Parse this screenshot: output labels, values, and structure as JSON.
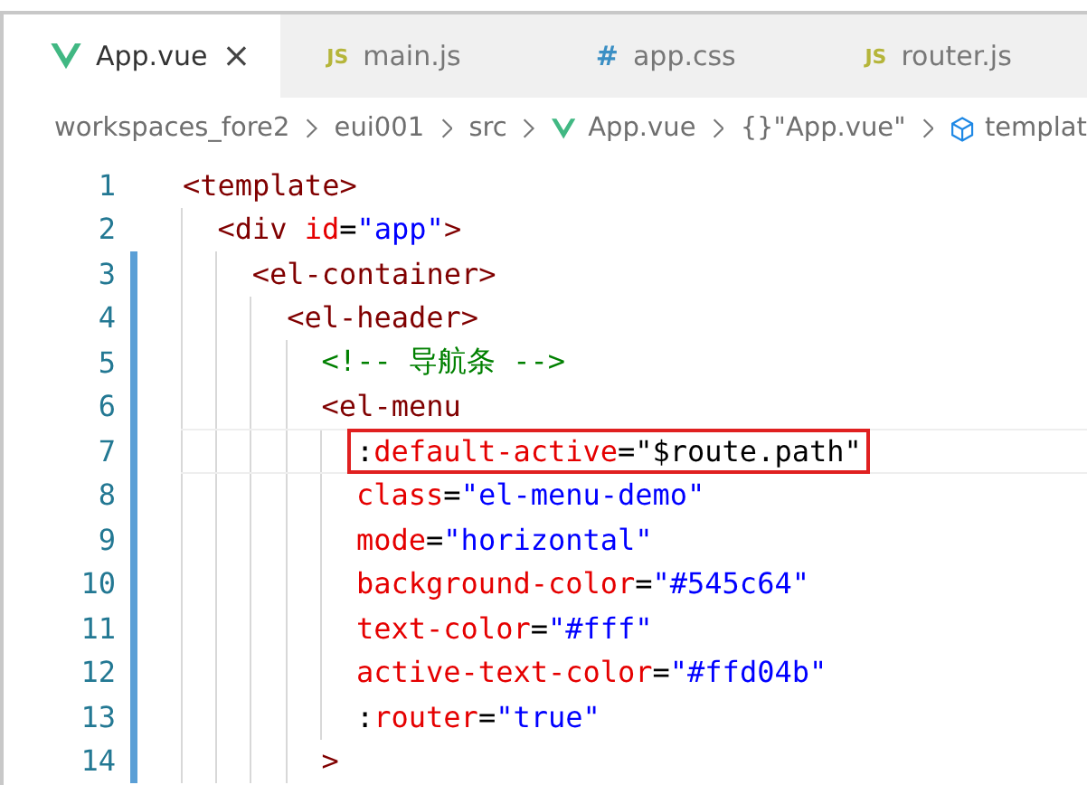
{
  "tabs": [
    {
      "label": "App.vue",
      "selected": true,
      "kind": "vue",
      "close": "×"
    },
    {
      "label": "main.js",
      "selected": false,
      "kind": "js",
      "badge": "JS"
    },
    {
      "label": "app.css",
      "selected": false,
      "kind": "css",
      "badge": "#"
    },
    {
      "label": "router.js",
      "selected": false,
      "kind": "js",
      "badge": "JS"
    }
  ],
  "breadcrumb": [
    {
      "text": "workspaces_fore2"
    },
    {
      "text": "eui001"
    },
    {
      "text": "src"
    },
    {
      "text": "App.vue",
      "kind": "vue"
    },
    {
      "text": "{}\"App.vue\""
    },
    {
      "text": "templat",
      "kind": "cube"
    }
  ],
  "lines": [
    {
      "number": "1",
      "modified": false,
      "boxed": false,
      "tokens": [
        {
          "kind": "tag",
          "text": "<template>"
        }
      ]
    },
    {
      "number": "2",
      "modified": false,
      "boxed": false,
      "tokens": [
        {
          "kind": "tag",
          "text": "  <div "
        },
        {
          "kind": "attr",
          "text": "id"
        },
        {
          "kind": "punct",
          "text": "="
        },
        {
          "kind": "string",
          "text": "\"app\""
        },
        {
          "kind": "tag",
          "text": ">"
        }
      ]
    },
    {
      "number": "3",
      "modified": true,
      "boxed": false,
      "tokens": [
        {
          "kind": "tag",
          "text": "    <el-container>"
        }
      ]
    },
    {
      "number": "4",
      "modified": true,
      "boxed": false,
      "tokens": [
        {
          "kind": "tag",
          "text": "      <el-header>"
        }
      ]
    },
    {
      "number": "5",
      "modified": true,
      "boxed": false,
      "tokens": [
        {
          "kind": "comment",
          "text": "        <!-- 导航条 -->"
        }
      ]
    },
    {
      "number": "6",
      "modified": true,
      "boxed": false,
      "tokens": [
        {
          "kind": "tag",
          "text": "        <el-menu"
        }
      ]
    },
    {
      "number": "7",
      "modified": true,
      "boxed": true,
      "tokens": [
        {
          "kind": "punct",
          "text": "          :"
        },
        {
          "kind": "attr",
          "text": "default-active"
        },
        {
          "kind": "punct",
          "text": "=\"$route.path\""
        }
      ]
    },
    {
      "number": "8",
      "modified": true,
      "boxed": false,
      "tokens": [
        {
          "kind": "attr",
          "text": "          class"
        },
        {
          "kind": "punct",
          "text": "="
        },
        {
          "kind": "string",
          "text": "\"el-menu-demo\""
        }
      ]
    },
    {
      "number": "9",
      "modified": true,
      "boxed": false,
      "tokens": [
        {
          "kind": "attr",
          "text": "          mode"
        },
        {
          "kind": "punct",
          "text": "="
        },
        {
          "kind": "string",
          "text": "\"horizontal\""
        }
      ]
    },
    {
      "number": "10",
      "modified": true,
      "boxed": false,
      "tokens": [
        {
          "kind": "attr",
          "text": "          background-color"
        },
        {
          "kind": "punct",
          "text": "="
        },
        {
          "kind": "string",
          "text": "\"#545c64\""
        }
      ]
    },
    {
      "number": "11",
      "modified": true,
      "boxed": false,
      "tokens": [
        {
          "kind": "attr",
          "text": "          text-color"
        },
        {
          "kind": "punct",
          "text": "="
        },
        {
          "kind": "string",
          "text": "\"#fff\""
        }
      ]
    },
    {
      "number": "12",
      "modified": true,
      "boxed": false,
      "tokens": [
        {
          "kind": "attr",
          "text": "          active-text-color"
        },
        {
          "kind": "punct",
          "text": "="
        },
        {
          "kind": "string",
          "text": "\"#ffd04b\""
        }
      ]
    },
    {
      "number": "13",
      "modified": true,
      "boxed": false,
      "tokens": [
        {
          "kind": "punct",
          "text": "          :"
        },
        {
          "kind": "attr",
          "text": "router"
        },
        {
          "kind": "punct",
          "text": "="
        },
        {
          "kind": "string",
          "text": "\"true\""
        }
      ]
    },
    {
      "number": "14",
      "modified": true,
      "boxed": false,
      "tokens": [
        {
          "kind": "tag",
          "text": "        >"
        }
      ]
    }
  ]
}
